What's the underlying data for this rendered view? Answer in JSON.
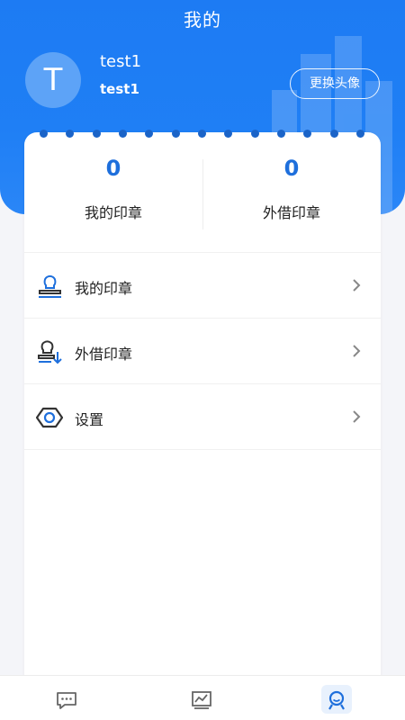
{
  "header": {
    "title": "我的",
    "avatar_initial": "T",
    "username": "test1",
    "nickname": "test1",
    "change_avatar_label": "更换头像"
  },
  "stats": [
    {
      "value": "0",
      "label": "我的印章"
    },
    {
      "value": "0",
      "label": "外借印章"
    }
  ],
  "menu": [
    {
      "label": "我的印章",
      "icon": "stamp-icon"
    },
    {
      "label": "外借印章",
      "icon": "stamp-lend-icon"
    },
    {
      "label": "设置",
      "icon": "settings-hexagon-icon"
    }
  ],
  "tabbar": [
    {
      "icon": "message-icon",
      "active": false
    },
    {
      "icon": "chart-icon",
      "active": false
    },
    {
      "icon": "profile-icon",
      "active": true
    }
  ],
  "colors": {
    "brand_blue": "#1d7bf3",
    "stat_blue": "#1e6fdc",
    "dot_blue": "#1b64c8",
    "background": "#f4f5f9"
  }
}
